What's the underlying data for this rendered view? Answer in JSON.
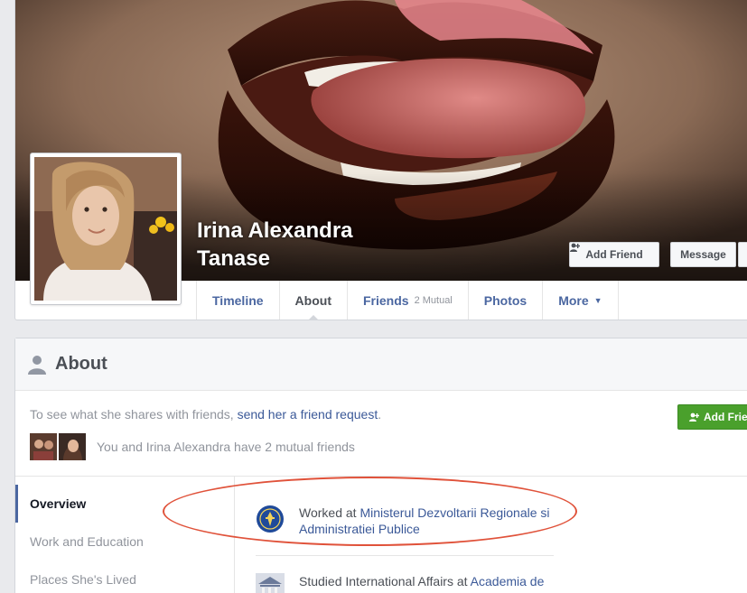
{
  "profile": {
    "name_line1": "Irina Alexandra",
    "name_line2": "Tanase"
  },
  "cover_buttons": {
    "add_friend": "Add Friend",
    "message": "Message",
    "more": "‹"
  },
  "nav_tabs": [
    {
      "label": "Timeline"
    },
    {
      "label": "About"
    },
    {
      "label": "Friends",
      "badge": "2 Mutual"
    },
    {
      "label": "Photos"
    },
    {
      "label": "More"
    }
  ],
  "about": {
    "title": "About",
    "share_prefix": "To see what she shares with friends, ",
    "share_link": "send her a friend request",
    "share_suffix": ".",
    "add_friend_button": "Add Friend",
    "mutual_text": "You and Irina Alexandra have 2 mutual friends"
  },
  "sidebar": {
    "items": [
      {
        "label": "Overview"
      },
      {
        "label": "Work and Education"
      },
      {
        "label": "Places She's Lived"
      }
    ]
  },
  "entries": {
    "work_prefix": "Worked at ",
    "work_link": "Ministerul Dezvoltarii Regionale si Administratiei Publice",
    "edu_prefix": "Studied International Affairs at ",
    "edu_link": "Academia de Studii Economice din Bucuresti"
  },
  "colors": {
    "link_blue": "#3b5998",
    "tab_blue": "#4b67a1",
    "green_button": "#4aa02c",
    "highlight_red": "#e0523a"
  },
  "icons": [
    "add-friend-icon",
    "caret-down-icon",
    "person-icon",
    "ministry-logo-icon",
    "university-icon"
  ]
}
